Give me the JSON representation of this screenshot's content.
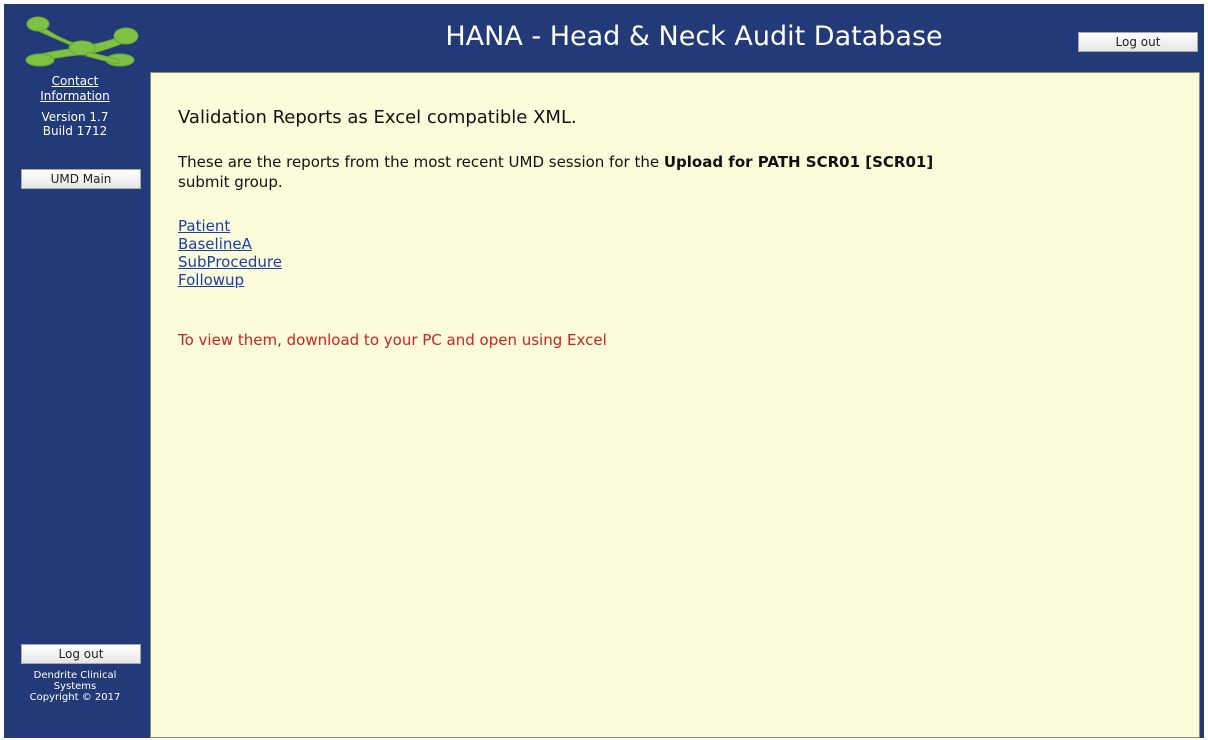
{
  "header": {
    "title": "HANA - Head & Neck Audit Database",
    "logout_label": "Log out"
  },
  "sidebar": {
    "contact_line1": "Contact",
    "contact_line2": "Information",
    "version": "Version 1.7",
    "build": "Build 1712",
    "umd_main_label": "UMD Main",
    "logout_label": "Log out",
    "copyright_line1": "Dendrite Clinical",
    "copyright_line2": "Systems",
    "copyright_line3": "Copyright © 2017"
  },
  "main": {
    "heading": "Validation Reports as Excel compatible XML.",
    "desc_prefix": "These are the reports from the most recent UMD session for the ",
    "desc_bold": "Upload for PATH SCR01 [SCR01]",
    "desc_suffix": " submit group.",
    "reports": [
      "Patient",
      "BaselineA",
      "SubProcedure",
      "Followup"
    ],
    "note": "To view them, download to your PC and open using Excel"
  },
  "colors": {
    "frame": "#233a78",
    "content_bg": "#fcfcdb",
    "link": "#1a3ea8",
    "note": "#cc2222",
    "logo_green": "#7dc242"
  }
}
